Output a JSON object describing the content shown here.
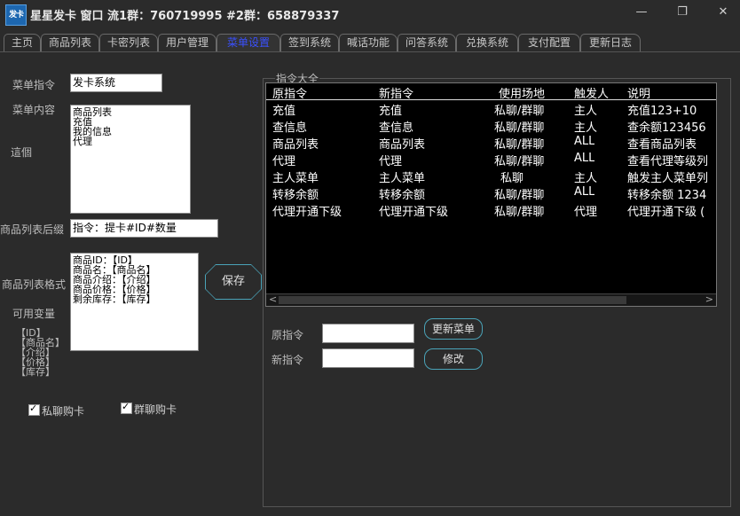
{
  "window": {
    "logo_text": "发卡",
    "title": "星星发卡 窗口 流1群：760719995 #2群：658879337",
    "minimize_label": "—",
    "maximize_label": "❐",
    "close_label": "✕"
  },
  "tabs": [
    {
      "label": "主页"
    },
    {
      "label": "商品列表"
    },
    {
      "label": "卡密列表"
    },
    {
      "label": "用户管理"
    },
    {
      "label": "菜单设置",
      "active": true
    },
    {
      "label": "签到系统"
    },
    {
      "label": "喊话功能"
    },
    {
      "label": "问答系统"
    },
    {
      "label": "兑换系统"
    },
    {
      "label": "支付配置"
    },
    {
      "label": "更新日志"
    }
  ],
  "left": {
    "menu_command_label": "菜单指令",
    "menu_command_value": "发卡系统",
    "menu_content_label": "菜单内容",
    "menu_content_hint": "這個",
    "menu_content_lines": [
      "商品列表",
      "充值",
      "我的信息",
      "代理"
    ],
    "suffix_label": "商品列表后缀",
    "suffix_value": "指令：提卡#ID#数量",
    "format_label": "商品列表格式",
    "format_lines": [
      "商品ID：【ID】",
      "商品名：【商品名】",
      "商品介绍：【介绍】",
      "商品价格：【价格】",
      "剩余库存：【库存】"
    ],
    "variables_label": "可用变量",
    "variables": [
      "【ID】",
      "【商品名】",
      "【介绍】",
      "【价格】",
      "【库存】"
    ],
    "save_button": "保存",
    "private_buy_label": "私聊购卡",
    "group_buy_label": "群聊购卡"
  },
  "right": {
    "group_title": "指令大全",
    "columns": [
      "原指令",
      "新指令",
      "使用场地",
      "触发人",
      "说明"
    ],
    "rows": [
      [
        "充值",
        "充值",
        "私聊/群聊",
        "主人",
        "充值123+10"
      ],
      [
        "查信息",
        "查信息",
        "私聊/群聊",
        "主人",
        "查余额123456"
      ],
      [
        "商品列表",
        "商品列表",
        "私聊/群聊",
        "ALL",
        "查看商品列表"
      ],
      [
        "代理",
        "代理",
        "私聊/群聊",
        "ALL",
        "查看代理等级列"
      ],
      [
        "主人菜单",
        "主人菜单",
        "私聊",
        "主人",
        "触发主人菜单列"
      ],
      [
        "转移余额",
        "转移余额",
        "私聊/群聊",
        "ALL",
        "转移余额 1234"
      ],
      [
        "代理开通下级",
        "代理开通下级",
        "私聊/群聊",
        "代理",
        "代理开通下级 ("
      ]
    ],
    "scroll_left": "<",
    "scroll_right": ">",
    "original_label": "原指令",
    "original_value": "",
    "new_label": "新指令",
    "new_value": "",
    "update_menu_button": "更新菜单",
    "modify_button": "修改"
  }
}
